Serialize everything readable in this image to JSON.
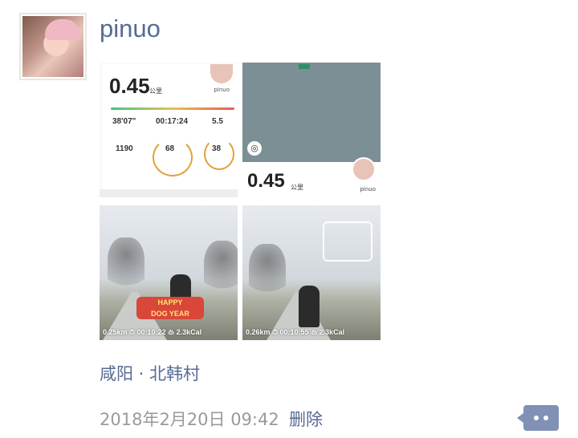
{
  "post": {
    "username": "pinuo",
    "location": "咸阳 · 北韩村",
    "timestamp": "2018年2月20日 09:42",
    "delete_label": "删除",
    "more_icon": "comment-dots-icon"
  },
  "images": [
    {
      "kind": "run-summary",
      "distance": "0.45",
      "unit": "公里",
      "user": "pinuo",
      "stats": [
        "38'07\"",
        "00:17:24",
        "5.5",
        "1190",
        "68",
        "38"
      ]
    },
    {
      "kind": "map-summary",
      "distance": "0.45",
      "unit": "公里",
      "user": "pinuo"
    },
    {
      "kind": "photo",
      "overlay": "0.25km   ⏱ 00:10:22   ♨ 2.3kCal",
      "sticker_text": "HAPPY\nDOG YEAR"
    },
    {
      "kind": "photo",
      "overlay": "0.26km   ⏱ 00:10:55   ♨ 2.3kCal"
    }
  ],
  "colors": {
    "link": "#576b95",
    "muted": "#9a9a9a",
    "more_button": "#8091b5"
  }
}
